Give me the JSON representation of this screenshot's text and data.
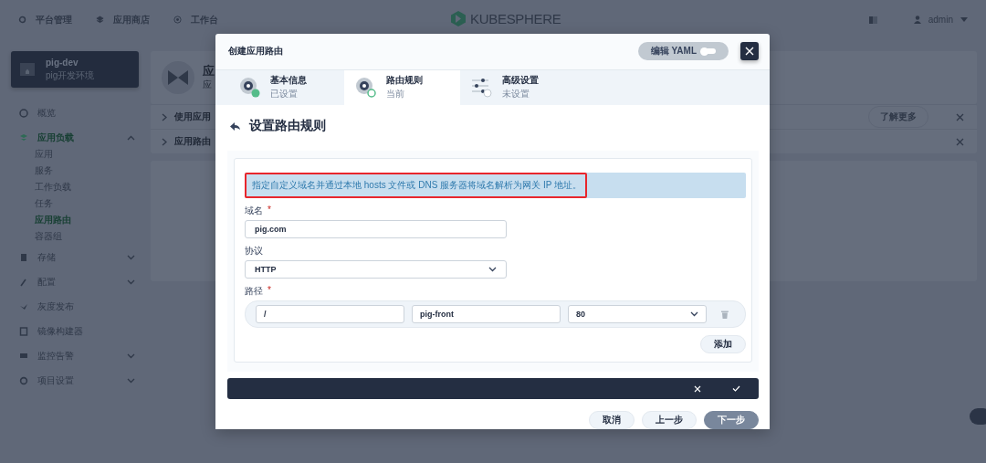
{
  "top_nav": {
    "items": [
      {
        "label": "平台管理"
      },
      {
        "label": "应用商店"
      },
      {
        "label": "工作台"
      }
    ],
    "logo": "KUBESPHERE",
    "user": "admin"
  },
  "project": {
    "name": "pig-dev",
    "description": "pig开发环境"
  },
  "sidebar": {
    "items": [
      {
        "kind": "link",
        "label": "概览"
      },
      {
        "kind": "group",
        "label": "应用负载",
        "expanded": true,
        "selected": true,
        "children": [
          {
            "label": "应用",
            "selected": false
          },
          {
            "label": "服务",
            "selected": false
          },
          {
            "label": "工作负载",
            "selected": false
          },
          {
            "label": "任务",
            "selected": false
          },
          {
            "label": "应用路由",
            "selected": true
          },
          {
            "label": "容器组",
            "selected": false
          }
        ]
      },
      {
        "kind": "group",
        "label": "存储",
        "expanded": false,
        "selected": false
      },
      {
        "kind": "group",
        "label": "配置",
        "expanded": false,
        "selected": false
      },
      {
        "kind": "link",
        "label": "灰度发布"
      },
      {
        "kind": "link",
        "label": "镜像构建器"
      },
      {
        "kind": "group",
        "label": "监控告警",
        "expanded": false,
        "selected": false
      },
      {
        "kind": "group",
        "label": "项目设置",
        "expanded": false,
        "selected": false
      }
    ]
  },
  "page": {
    "title": "应",
    "subtitle": "应",
    "banners": [
      {
        "text": "使用应用",
        "button": "了解更多"
      },
      {
        "text": "应用路由"
      }
    ]
  },
  "modal": {
    "title": "创建应用路由",
    "yaml_toggle": {
      "label": "编辑 YAML",
      "on": false
    },
    "steps": [
      {
        "title": "基本信息",
        "status": "已设置",
        "completed": true,
        "selected": false
      },
      {
        "title": "路由规则",
        "status": "当前",
        "completed": false,
        "selected": true
      },
      {
        "title": "高级设置",
        "status": "未设置",
        "completed": false,
        "selected": false
      }
    ],
    "heading": "设置路由规则",
    "notice": {
      "text": "指定自定义域名并通过本地 hosts 文件或 DNS 服务器将域名解析为网关 IP 地址。",
      "highlighted": true
    },
    "fields": [
      {
        "kind": "text",
        "label": "域名",
        "required_mark": "*",
        "value": "pig.com"
      },
      {
        "kind": "select",
        "label": "协议",
        "value": "HTTP"
      },
      {
        "kind": "paths",
        "label": "路径",
        "required_mark": "*",
        "rows": [
          {
            "path": "/",
            "service": "pig-front",
            "port": "80"
          }
        ],
        "add_button": "添加"
      }
    ],
    "footer": [
      {
        "label": "取消",
        "primary": false
      },
      {
        "label": "上一步",
        "primary": false
      },
      {
        "label": "下一步",
        "primary": true
      }
    ]
  }
}
